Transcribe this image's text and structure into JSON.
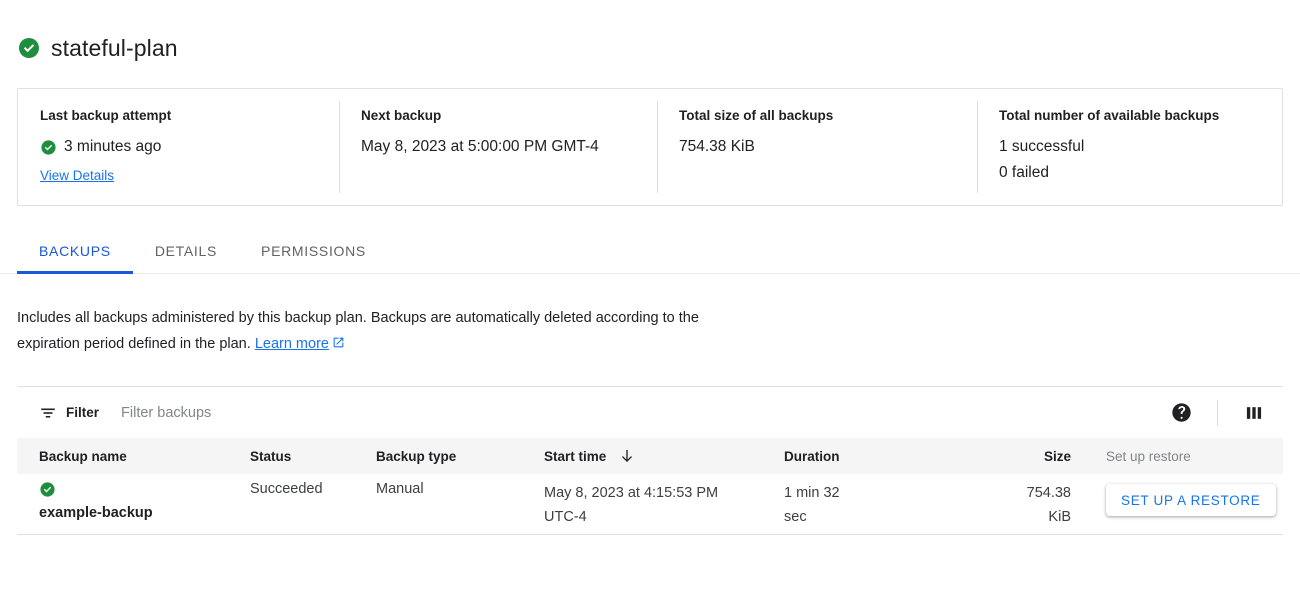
{
  "header": {
    "status_icon": "check-circle-icon",
    "title": "stateful-plan",
    "accent_green": "#1e8e3e",
    "accent_blue": "#1a73e8"
  },
  "summary": {
    "cells": [
      {
        "label": "Last backup attempt",
        "value": "3 minutes ago",
        "has_status_icon": true,
        "link": "View Details"
      },
      {
        "label": "Next backup",
        "value": "May 8, 2023 at 5:00:00 PM GMT-4",
        "has_status_icon": false,
        "link": ""
      },
      {
        "label": "Total size of all backups",
        "value": "754.38 KiB",
        "has_status_icon": false,
        "link": ""
      },
      {
        "label": "Total number of available backups",
        "value": "1 successful",
        "value2": "0 failed",
        "has_status_icon": false,
        "link": ""
      }
    ]
  },
  "tabs": [
    {
      "label": "BACKUPS",
      "active": true
    },
    {
      "label": "DETAILS",
      "active": false
    },
    {
      "label": "PERMISSIONS",
      "active": false
    }
  ],
  "description": {
    "text": "Includes all backups administered by this backup plan. Backups are automatically deleted according to the expiration period defined in the plan.",
    "link_label": "Learn more",
    "link_icon": "external-link-icon"
  },
  "toolbar": {
    "filter_icon": "filter-icon",
    "filter_label": "Filter",
    "filter_placeholder": "Filter backups",
    "help_icon": "help-icon",
    "columns_icon": "column-display-icon"
  },
  "table": {
    "columns": [
      {
        "label": "Backup name",
        "sort": ""
      },
      {
        "label": "Status",
        "sort": ""
      },
      {
        "label": "Backup type",
        "sort": ""
      },
      {
        "label": "Start time",
        "sort": "desc"
      },
      {
        "label": "Duration",
        "sort": ""
      },
      {
        "label": "Size",
        "sort": ""
      },
      {
        "label": "Set up restore",
        "sort": ""
      }
    ],
    "rows": [
      {
        "status_icon": "check-circle-icon",
        "name": "example-backup",
        "status": "Succeeded",
        "type": "Manual",
        "start_time": "May 8, 2023 at 4:15:53 PM",
        "start_time_2": "UTC-4",
        "duration": "1 min 32",
        "duration_2": "sec",
        "size": "754.38",
        "size_2": "KiB",
        "action_label": "SET UP A RESTORE"
      }
    ]
  }
}
